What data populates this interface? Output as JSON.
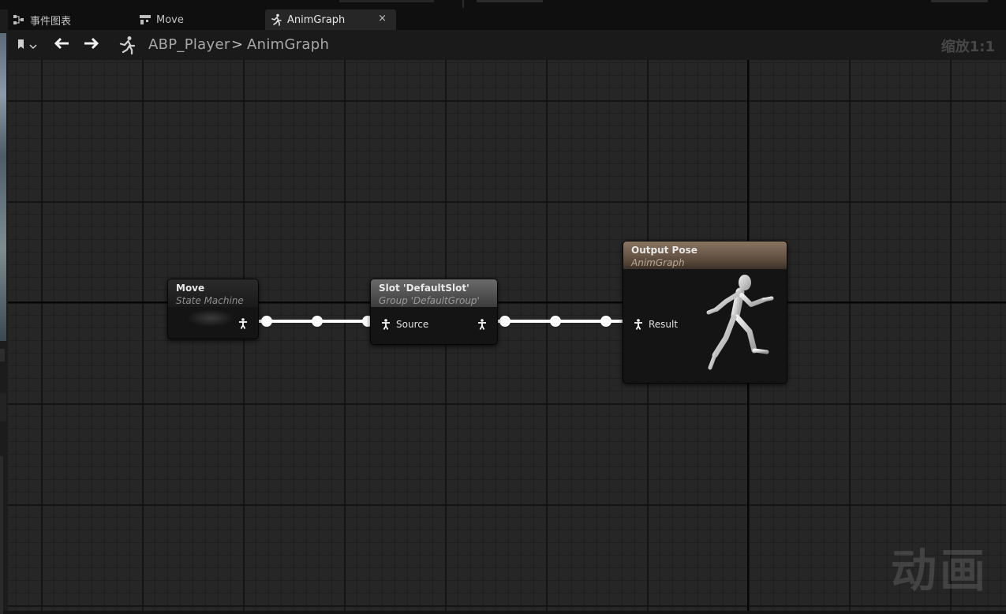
{
  "tabs": [
    {
      "label": "事件图表",
      "icon": "event-graph-icon"
    },
    {
      "label": "Move",
      "icon": "state-machine-icon"
    },
    {
      "label": "AnimGraph",
      "icon": "anim-graph-icon",
      "active": true,
      "close": "×"
    }
  ],
  "breadcrumb": {
    "root": "ABP_Player",
    "separator": ">",
    "current": "AnimGraph"
  },
  "zoom_label": "缩放1:1",
  "watermark": "动画",
  "nodes": {
    "move": {
      "title": "Move",
      "subtitle": "State Machine"
    },
    "slot": {
      "title": "Slot 'DefaultSlot'",
      "subtitle": "Group 'DefaultGroup'",
      "input_pin": "Source"
    },
    "output": {
      "title": "Output Pose",
      "subtitle": "AnimGraph",
      "input_pin": "Result"
    }
  },
  "colors": {
    "canvas": "#262626",
    "wire": "#ffffff",
    "output_header": "#6e5a48",
    "slot_header": "#5a5a5a"
  }
}
